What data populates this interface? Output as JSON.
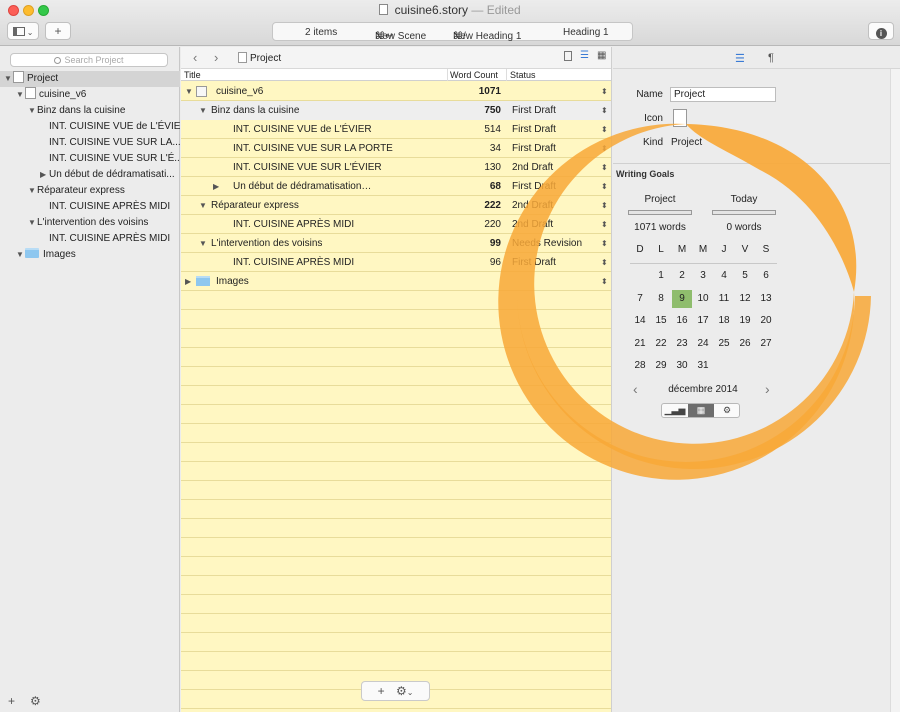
{
  "window": {
    "title": "cuisine6.story",
    "edited": "Edited"
  },
  "toolbar": {
    "items_count": "2 items",
    "new_scene_shortcut": "⌘↩",
    "new_scene": "New Scene",
    "new_heading_shortcut": "⌘/",
    "new_heading": "New Heading 1",
    "heading_style": "Heading 1",
    "add_label": "+",
    "info_label": "i"
  },
  "sidebar": {
    "search_placeholder": "Search Project",
    "items": [
      {
        "label": "Project",
        "level": 0,
        "expanded": true,
        "icon": "file-icon",
        "selected": true
      },
      {
        "label": "cuisine_v6",
        "level": 1,
        "expanded": true,
        "icon": "stack-icon"
      },
      {
        "label": "Binz dans la cuisine",
        "level": 2,
        "expanded": true
      },
      {
        "label": "INT. CUISINE VUE de L'ÉVIER",
        "level": 3
      },
      {
        "label": "INT. CUISINE VUE SUR LA...",
        "level": 3
      },
      {
        "label": "INT. CUISINE VUE SUR L'É...",
        "level": 3
      },
      {
        "label": "Un début de dédramatisati...",
        "level": 3,
        "collapsed": true
      },
      {
        "label": "Réparateur express",
        "level": 2,
        "expanded": true
      },
      {
        "label": "INT. CUISINE APRÈS MIDI",
        "level": 3
      },
      {
        "label": "L'intervention des voisins",
        "level": 2,
        "expanded": true
      },
      {
        "label": "INT. CUISINE APRÈS MIDI",
        "level": 3
      },
      {
        "label": "Images",
        "level": 1,
        "expanded": true,
        "icon": "folder-icon"
      }
    ],
    "add_label": "+",
    "gear_label": "⚙"
  },
  "outline": {
    "breadcrumb": "Project",
    "columns": {
      "title": "Title",
      "word_count": "Word Count",
      "status": "Status"
    },
    "rows": [
      {
        "title": "cuisine_v6",
        "wc": "1071",
        "status": "",
        "indent": 0,
        "bold_wc": true,
        "tri": "▼",
        "icon": "stack"
      },
      {
        "title": "Binz dans la cuisine",
        "wc": "750",
        "status": "First Draft",
        "indent": 1,
        "bold_wc": true,
        "tri": "▼",
        "hl": true
      },
      {
        "title": "INT. CUISINE VUE de L'ÉVIER",
        "wc": "514",
        "status": "First Draft",
        "indent": 2
      },
      {
        "title": "INT. CUISINE VUE SUR LA PORTE",
        "wc": "34",
        "status": "First Draft",
        "indent": 2
      },
      {
        "title": "INT. CUISINE VUE SUR L'ÉVIER",
        "wc": "130",
        "status": "2nd Draft",
        "indent": 2
      },
      {
        "title": "Un début de dédramatisation…",
        "wc": "68",
        "status": "First Draft",
        "indent": 2,
        "bold_wc": true,
        "tri": "▶"
      },
      {
        "title": "Réparateur express",
        "wc": "222",
        "status": "2nd Draft",
        "indent": 1,
        "bold_wc": true,
        "tri": "▼"
      },
      {
        "title": "INT. CUISINE APRÈS MIDI",
        "wc": "220",
        "status": "2nd Draft",
        "indent": 2
      },
      {
        "title": "L'intervention des voisins",
        "wc": "99",
        "status": "Needs Revision",
        "indent": 1,
        "bold_wc": true,
        "tri": "▼"
      },
      {
        "title": "INT. CUISINE APRÈS MIDI",
        "wc": "96",
        "status": "First Draft",
        "indent": 2
      },
      {
        "title": "Images",
        "wc": "",
        "status": "",
        "indent": 0,
        "tri": "▶",
        "icon": "folder"
      }
    ],
    "add_label": "+",
    "gear_label": "⚙"
  },
  "inspector": {
    "tab_outline": "☰",
    "tab_paragraph": "¶",
    "name_label": "Name",
    "name_value": "Project",
    "icon_label": "Icon",
    "kind_label": "Kind",
    "kind_value": "Project",
    "goals_heading": "Writing Goals",
    "project_label": "Project",
    "today_label": "Today",
    "project_words": "1071 words",
    "today_words": "0 words",
    "weekdays": [
      "D",
      "L",
      "M",
      "M",
      "J",
      "V",
      "S"
    ],
    "month": "décembre 2014",
    "first_weekday_index": 1,
    "days_in_month": 31,
    "today_day": 9,
    "prev": "‹",
    "next": "›"
  },
  "colors": {
    "accent_orange": "#f8a837",
    "today_green": "#8fbd6d",
    "outline_bg": "#fff7c2"
  }
}
